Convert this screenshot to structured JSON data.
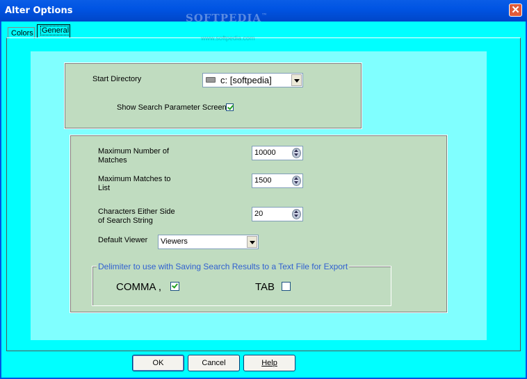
{
  "window": {
    "title": "Alter Options",
    "close_glyph": "✕",
    "watermark": "SOFTPEDIA",
    "watermark_tm": "™",
    "watermark_url": "www.softpedia.com"
  },
  "tabs": [
    {
      "label": "Colors",
      "active": false
    },
    {
      "label": "General",
      "active": true
    }
  ],
  "directory": {
    "label": "Start Directory",
    "drive_value": "c: [softpedia]",
    "drive_icon": "drive-icon"
  },
  "show_search": {
    "label": "Show Search Parameter Screen",
    "checked": true
  },
  "max_matches": {
    "label_line1": "Maximum Number of",
    "label_line2": "Matches",
    "value": "10000"
  },
  "max_list": {
    "label_line1": "Maximum Matches to",
    "label_line2": "List",
    "value": "1500"
  },
  "chars_side": {
    "label_line1": "Characters Either Side",
    "label_line2": "of Search String",
    "value": "20"
  },
  "viewer": {
    "label": "Default Viewer",
    "value": "Viewers"
  },
  "delimiter": {
    "legend": "Delimiter to use with Saving Search Results to a Text File for Export",
    "comma_label": "COMMA ,",
    "comma_checked": true,
    "tab_label": "TAB",
    "tab_checked": false
  },
  "buttons": {
    "ok": "OK",
    "cancel": "Cancel",
    "help": "Help"
  },
  "colors": {
    "background": "#00FFFF",
    "inner_panel": "#80FFFF",
    "group_box": "#C0DCC0",
    "titlebar": "#0054E3",
    "legend_text": "#3060D0"
  }
}
